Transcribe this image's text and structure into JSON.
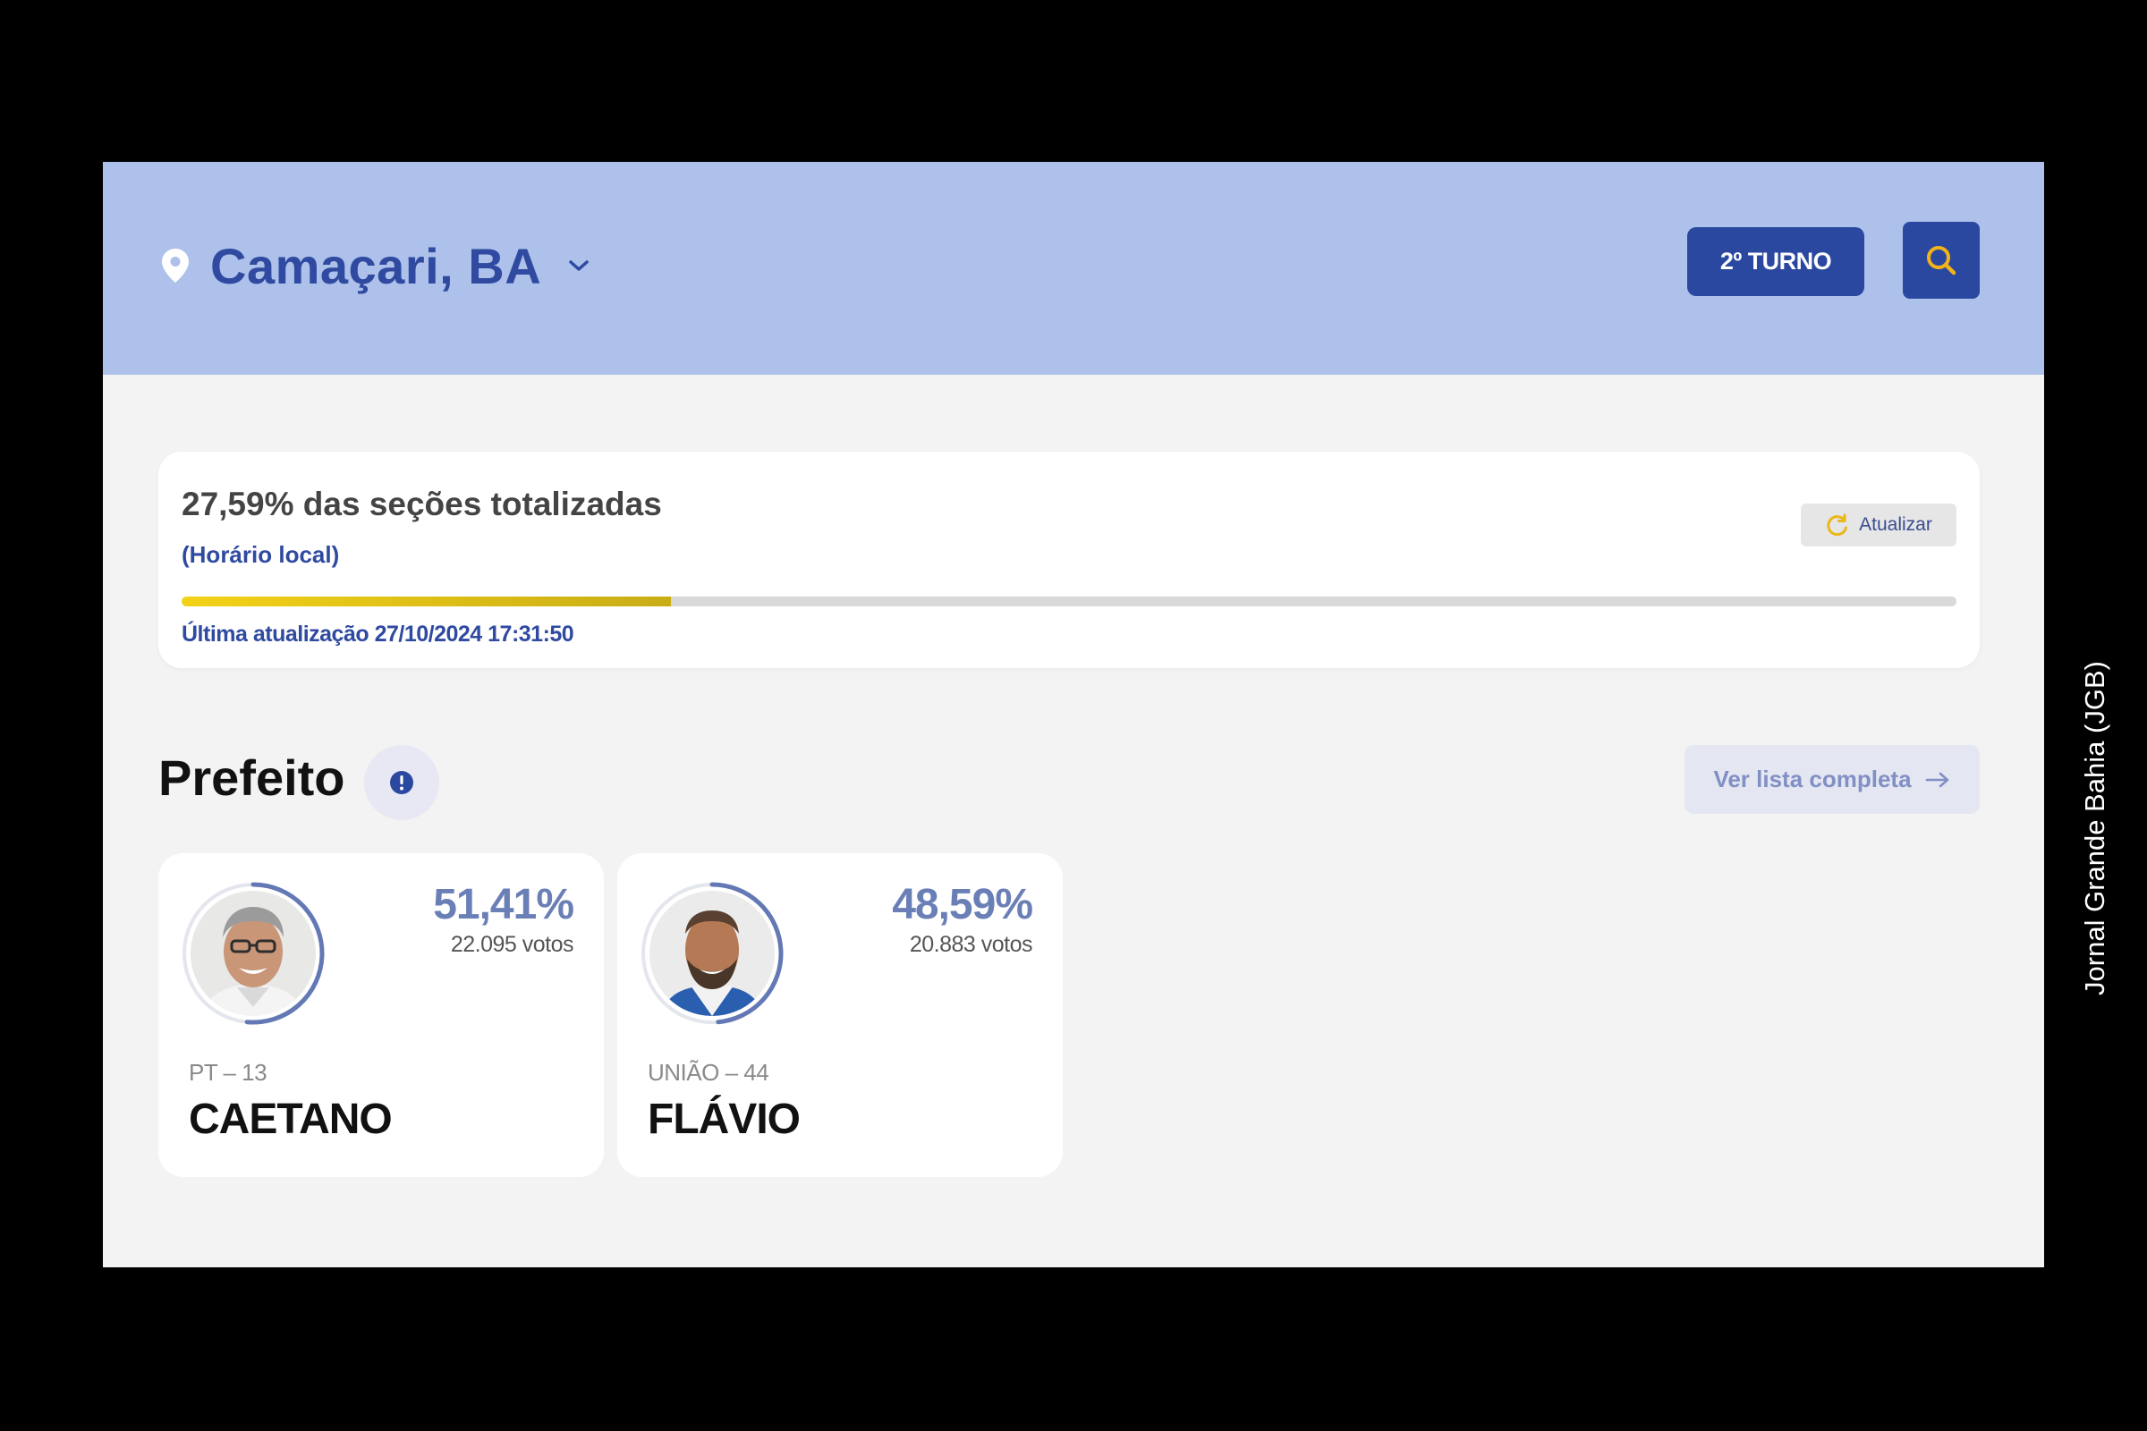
{
  "header": {
    "location": "Camaçari, BA",
    "round_button": "2º TURNO"
  },
  "status": {
    "title": "27,59% das seções totalizadas",
    "timezone_note": "(Horário local)",
    "refresh_label": "Atualizar",
    "progress_percent": 27.59,
    "last_update": "Última atualização 27/10/2024 17:31:50"
  },
  "section": {
    "title": "Prefeito",
    "full_list_label": "Ver lista completa"
  },
  "candidates": [
    {
      "name": "CAETANO",
      "party": "PT – 13",
      "percent": "51,41%",
      "votes": "22.095 votos",
      "share": 0.5141
    },
    {
      "name": "FLÁVIO",
      "party": "UNIÃO – 44",
      "percent": "48,59%",
      "votes": "20.883 votos",
      "share": 0.4859
    }
  ],
  "watermark": "Jornal Grande Bahia (JGB)",
  "colors": {
    "header_bg": "#adc1ea",
    "accent": "#2b48a0",
    "progress": "#f3d217",
    "percent_text": "#6b7fb7"
  },
  "icons": {
    "pin": "map-pin-icon",
    "chevron": "chevron-down-icon",
    "search": "search-icon",
    "refresh": "refresh-icon",
    "info": "info-icon",
    "arrow": "arrow-right-icon"
  }
}
